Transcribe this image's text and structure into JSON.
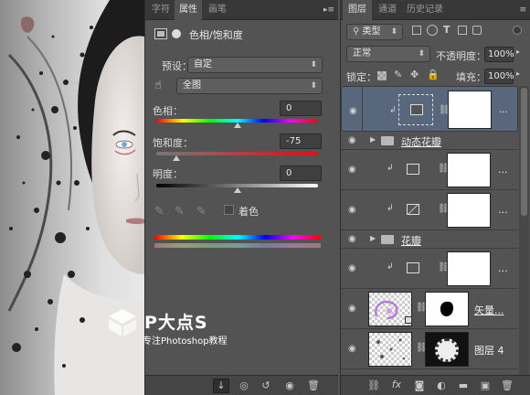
{
  "watermark": {
    "title": "P大点S",
    "subtitle": "专注Photoshop教程"
  },
  "props_panel": {
    "tabs": [
      "字符",
      "属性",
      "画笔"
    ],
    "active_tab": "属性",
    "menu": "▸≡",
    "header": "色相/饱和度",
    "preset_label": "预设：",
    "preset_value": "自定",
    "channel_value": "全图",
    "hue_label": "色相：",
    "hue_value": "0",
    "hue_fraction": 0.5,
    "sat_label": "饱和度：",
    "sat_value": "-75",
    "sat_fraction": 0.125,
    "light_label": "明度：",
    "light_value": "0",
    "light_fraction": 0.5,
    "colorize_label": "着色"
  },
  "layers_panel": {
    "tabs": [
      "图层",
      "通道",
      "历史记录"
    ],
    "active_tab": "图层",
    "menu": "≡",
    "filter_value": "类型",
    "blend_mode": "正常",
    "opacity_label": "不透明度：",
    "opacity_value": "100%",
    "lock_label": "锁定：",
    "fill_label": "填充：",
    "fill_value": "100%",
    "layers": [
      {
        "type": "adjustment",
        "name": "...",
        "selected": true
      },
      {
        "type": "group",
        "name": "动态花瓣"
      },
      {
        "type": "adjustment",
        "name": "..."
      },
      {
        "type": "curves",
        "name": "..."
      },
      {
        "type": "group",
        "name": "花瓣"
      },
      {
        "type": "adjustment",
        "name": "..."
      },
      {
        "type": "smart",
        "name": "矢量..."
      },
      {
        "type": "image",
        "name": "图层 4"
      }
    ]
  },
  "colors": {
    "panel_bg": "#535353",
    "tab_bg": "#383838",
    "selected_layer": "#59677c",
    "field_bg": "#3f3f3f"
  }
}
